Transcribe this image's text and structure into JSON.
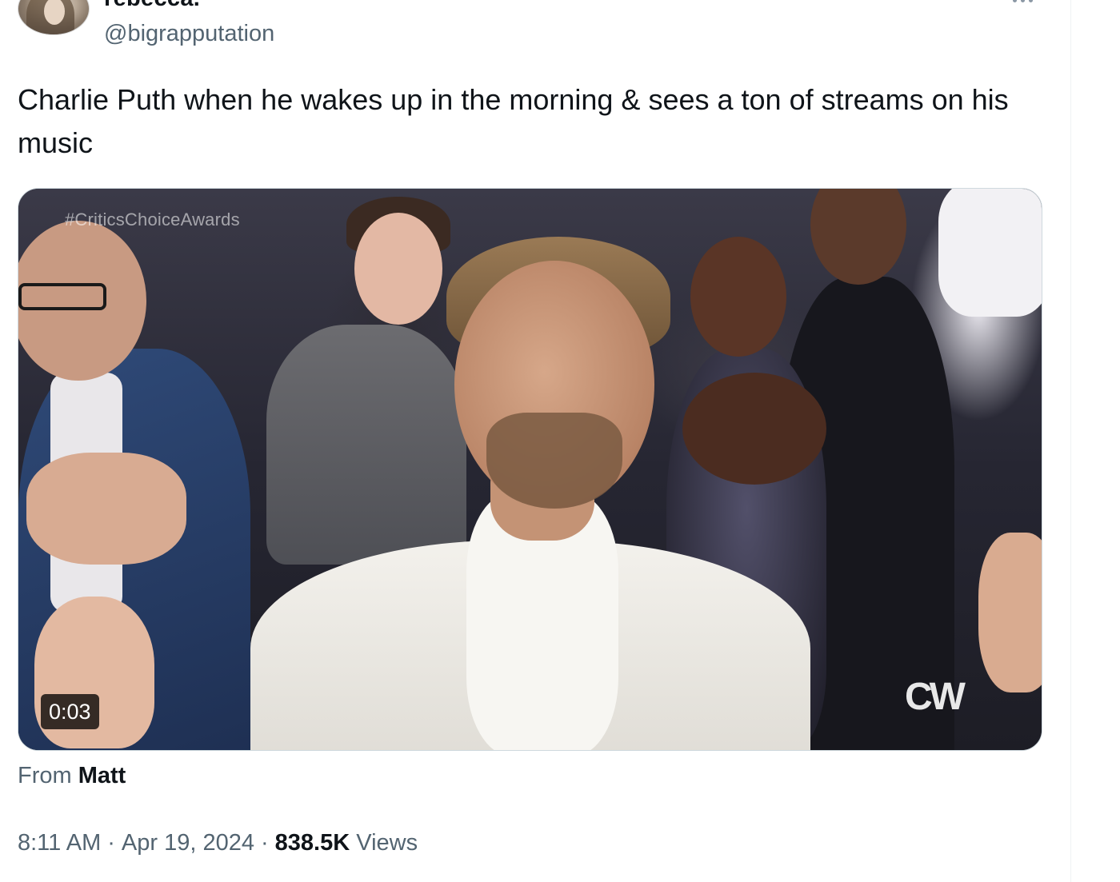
{
  "author": {
    "display_name": "rebecca.",
    "handle": "@bigrapputation"
  },
  "tweet": {
    "text": "Charlie Puth when he wakes up in the morning & sees a ton of streams on his music"
  },
  "media": {
    "watermark": "#CriticsChoiceAwards",
    "network_logo": "CW",
    "duration": "0:03"
  },
  "source": {
    "prefix": "From",
    "name": "Matt"
  },
  "meta": {
    "time": "8:11 AM",
    "separator": "·",
    "date": "Apr 19, 2024",
    "views_count": "838.5K",
    "views_label": "Views"
  },
  "icons": {
    "more": "more-dots-icon"
  },
  "colors": {
    "text_primary": "#0f1419",
    "text_secondary": "#536471",
    "border": "#cfd9de"
  }
}
